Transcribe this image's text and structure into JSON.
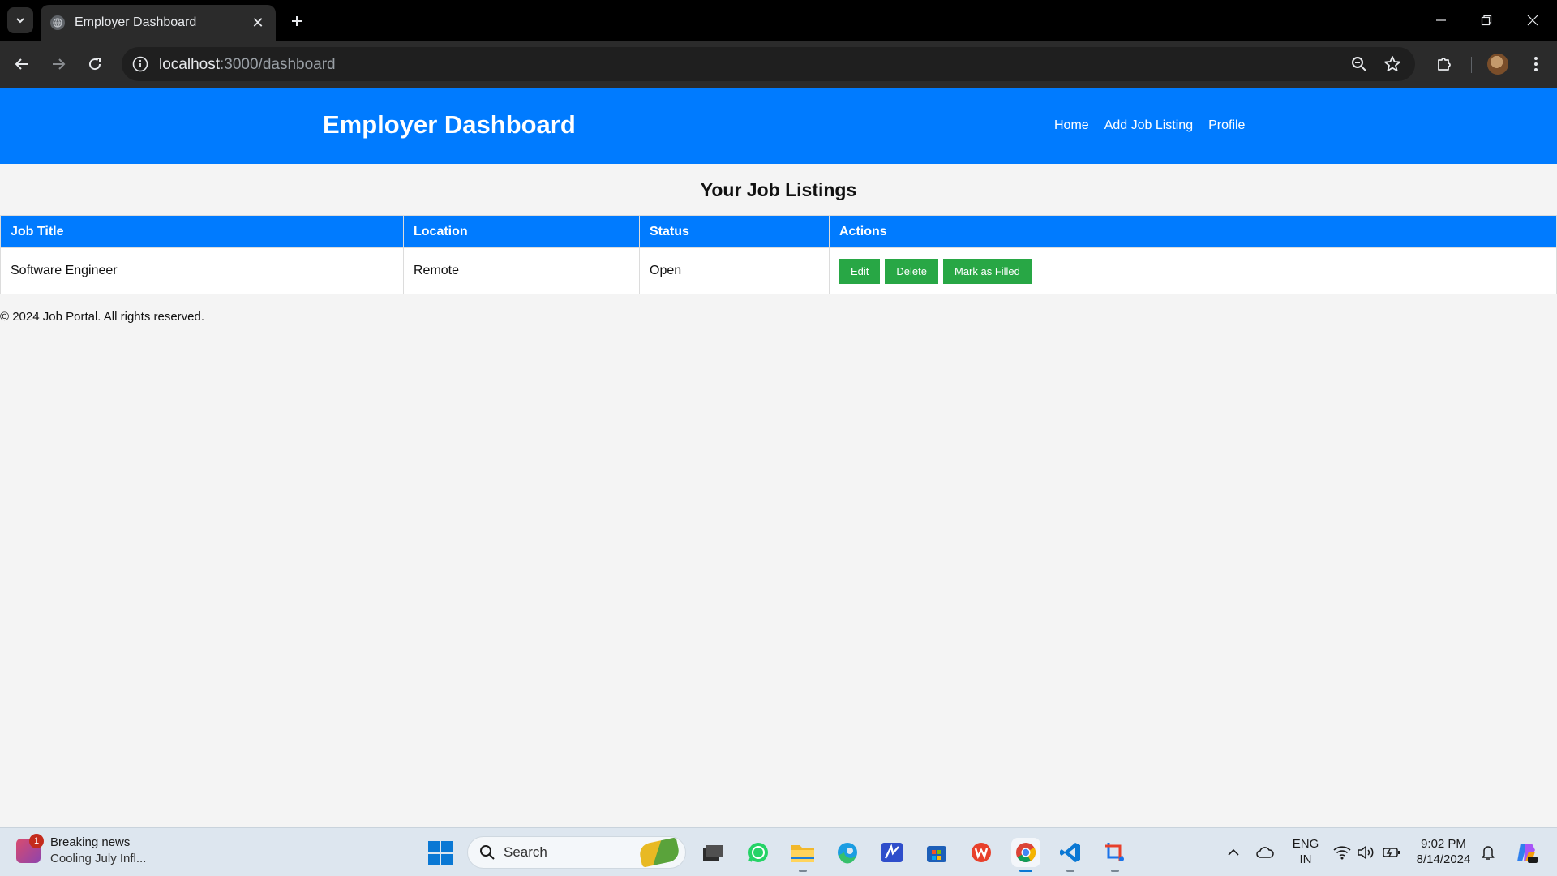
{
  "browser": {
    "tab_title": "Employer Dashboard",
    "tab_close_glyph": "✕",
    "new_tab_glyph": "+",
    "url_host": "localhost",
    "url_path": ":3000/dashboard",
    "icons": [
      "tab-list-icon",
      "globe-icon",
      "back-icon",
      "forward-icon",
      "reload-icon",
      "info-icon",
      "zoom-icon",
      "star-icon",
      "extensions-icon",
      "profile-avatar",
      "more-icon",
      "minimize-icon",
      "restore-icon",
      "close-icon"
    ]
  },
  "page": {
    "brand": "Employer Dashboard",
    "nav": [
      "Home",
      "Add Job Listing",
      "Profile"
    ],
    "section_title": "Your Job Listings",
    "table": {
      "headers": [
        "Job Title",
        "Location",
        "Status",
        "Actions"
      ],
      "rows": [
        {
          "job_title": "Software Engineer",
          "location": "Remote",
          "status": "Open",
          "actions": [
            "Edit",
            "Delete",
            "Mark as Filled"
          ]
        }
      ]
    },
    "footer": "© 2024 Job Portal. All rights reserved.",
    "colors": {
      "primary": "#007bff",
      "action": "#28a745",
      "background": "#f4f4f4"
    }
  },
  "taskbar": {
    "news_badge": "1",
    "news_title": "Breaking news",
    "news_subtitle": "Cooling July Infl...",
    "search_label": "Search",
    "lang_top": "ENG",
    "lang_bottom": "IN",
    "time": "9:02 PM",
    "date": "8/14/2024",
    "apps": [
      "file-manager-icon",
      "whatsapp-icon",
      "file-explorer-icon",
      "edge-icon",
      "pen-app-icon",
      "store-icon",
      "wps-icon",
      "chrome-icon",
      "vscode-icon",
      "snipping-tool-icon"
    ]
  }
}
